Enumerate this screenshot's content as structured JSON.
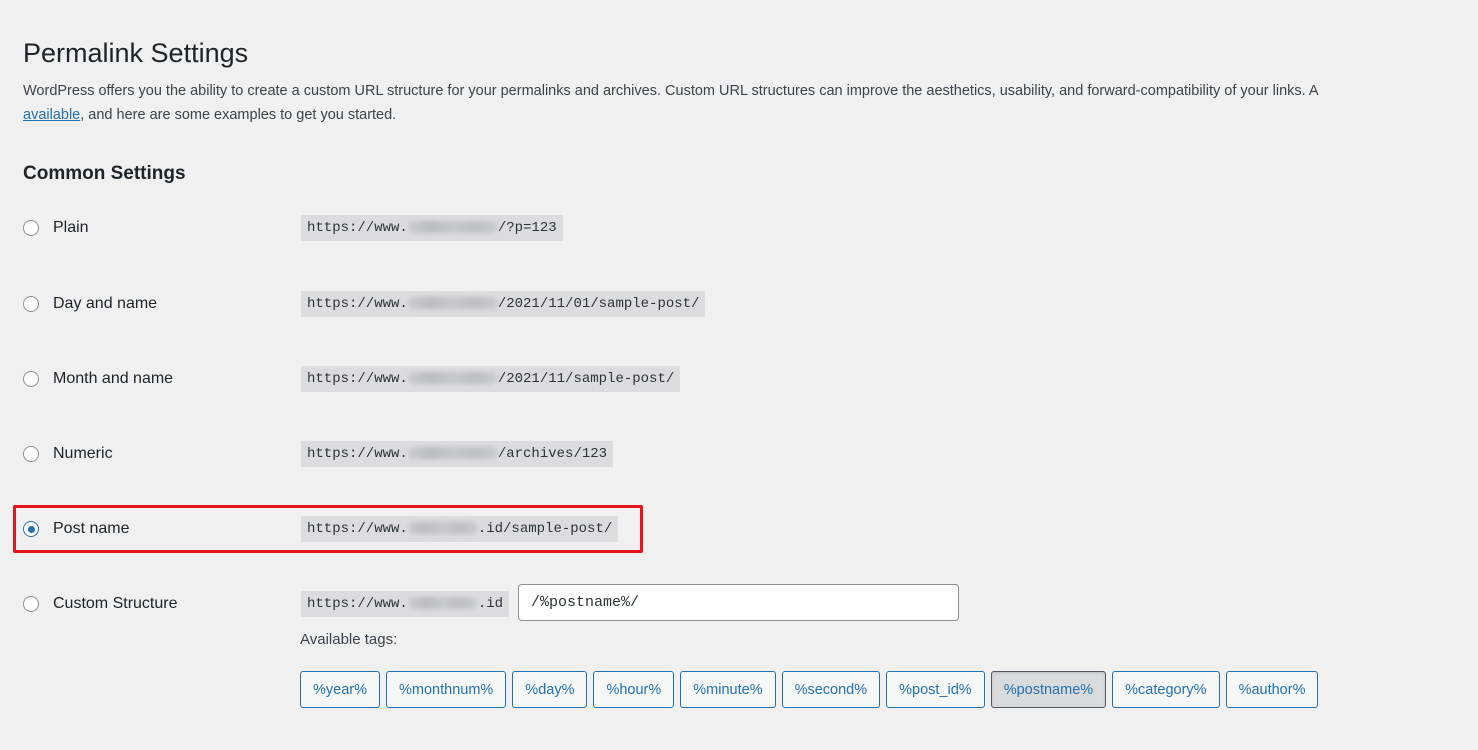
{
  "page": {
    "title": "Permalink Settings",
    "intro_line1": "WordPress offers you the ability to create a custom URL structure for your permalinks and archives. Custom URL structures can improve the aesthetics, usability, and forward-compatibility of your links. A",
    "intro_link": "available",
    "intro_line2_rest": ", and here are some examples to get you started.",
    "section_title": "Common Settings"
  },
  "options": [
    {
      "label": "Plain",
      "url_prefix": "https://www.",
      "url_suffix": "/?p=123",
      "checked": false
    },
    {
      "label": "Day and name",
      "url_prefix": "https://www.",
      "url_suffix": "/2021/11/01/sample-post/",
      "checked": false
    },
    {
      "label": "Month and name",
      "url_prefix": "https://www.",
      "url_suffix": "/2021/11/sample-post/",
      "checked": false
    },
    {
      "label": "Numeric",
      "url_prefix": "https://www.",
      "url_suffix": "/archives/123",
      "checked": false
    },
    {
      "label": "Post name",
      "url_prefix": "https://www.",
      "url_suffix": ".id/sample-post/",
      "checked": true
    },
    {
      "label": "Custom Structure",
      "url_prefix": "https://www.",
      "url_suffix": ".id",
      "checked": false
    }
  ],
  "custom_structure": {
    "value": "/%postname%/",
    "available_tags_label": "Available tags:",
    "tags": [
      "%year%",
      "%monthnum%",
      "%day%",
      "%hour%",
      "%minute%",
      "%second%",
      "%post_id%",
      "%postname%",
      "%category%",
      "%author%"
    ],
    "active_tag": "%postname%"
  },
  "colors": {
    "accent": "#2271b1",
    "highlight_border": "#e3161d",
    "background": "#f0f0f1"
  }
}
